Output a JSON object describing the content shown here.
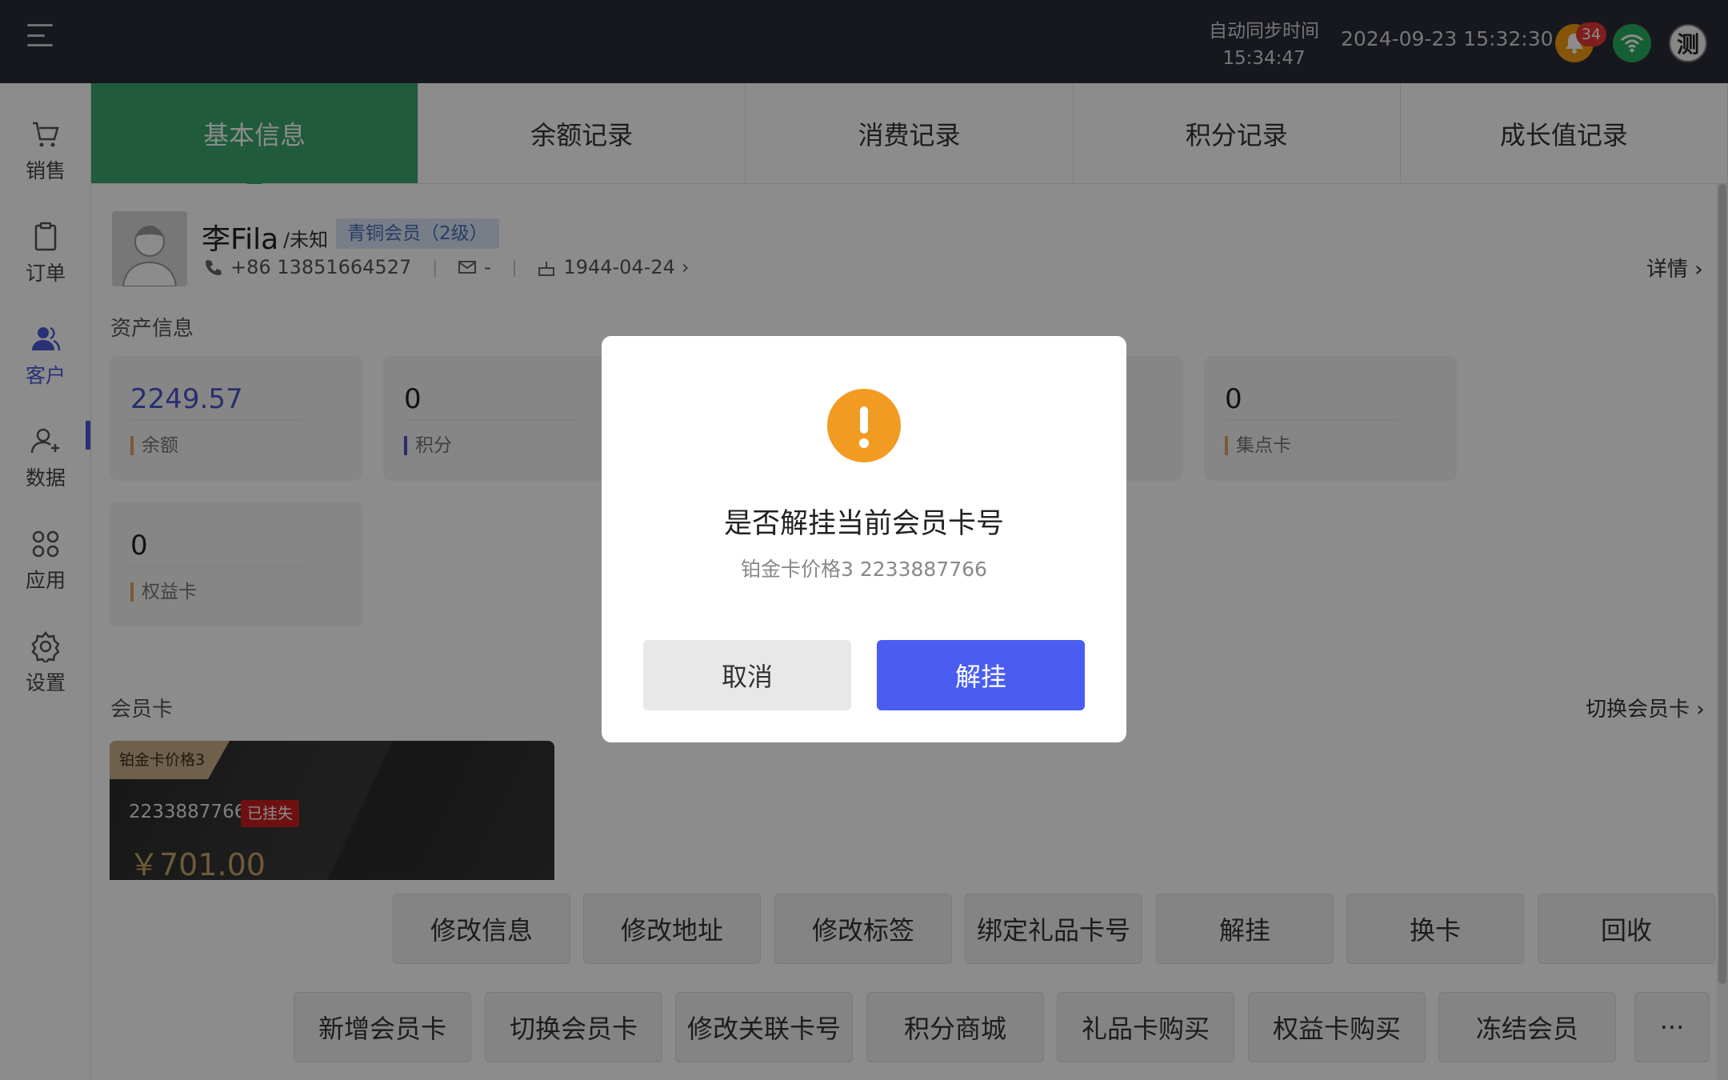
{
  "header": {
    "sync_label": "自动同步时间",
    "sync_time": "15:34:47",
    "datetime": "2024-09-23 15:32:30",
    "notification_count": "34",
    "avatar_glyph": "测"
  },
  "sidebar": {
    "items": [
      {
        "label": "销售",
        "icon": "cart-icon"
      },
      {
        "label": "订单",
        "icon": "clipboard-icon"
      },
      {
        "label": "客户",
        "icon": "users-icon"
      },
      {
        "label": "数据",
        "icon": "user-stats-icon"
      },
      {
        "label": "应用",
        "icon": "grid-apps-icon"
      },
      {
        "label": "设置",
        "icon": "gear-icon"
      }
    ],
    "active_index": 2
  },
  "tabs": [
    "基本信息",
    "余额记录",
    "消费记录",
    "积分记录",
    "成长值记录"
  ],
  "profile": {
    "name": "李Fila",
    "gender": "/未知",
    "level": "青铜会员（2级）",
    "phone": "+86 13851664527",
    "email": "-",
    "birthday": "1944-04-24",
    "birthday_chevron": "›",
    "detail_link": "详情 ›"
  },
  "assets": {
    "title": "资产信息",
    "items": [
      {
        "value": "2249.57",
        "label": "余额"
      },
      {
        "value": "0",
        "label": "积分"
      },
      {
        "value": "0",
        "label": "集点卡"
      },
      {
        "value": "0",
        "label": "权益卡"
      }
    ]
  },
  "member_card": {
    "title": "会员卡",
    "switch_link": "切换会员卡 ›",
    "tag": "铂金卡价格3",
    "card_no": "2233887766",
    "status": "已挂失",
    "amount": "￥701.00"
  },
  "actions": {
    "row1": [
      "修改信息",
      "修改地址",
      "修改标签",
      "绑定礼品卡号",
      "解挂",
      "换卡",
      "回收"
    ],
    "row2": [
      "新增会员卡",
      "切换会员卡",
      "修改关联卡号",
      "积分商城",
      "礼品卡购买",
      "权益卡购买",
      "冻结会员"
    ],
    "more": "···"
  },
  "dialog": {
    "title": "是否解挂当前会员卡号",
    "subtitle": "铂金卡价格3 2233887766",
    "cancel": "取消",
    "confirm": "解挂"
  },
  "colors": {
    "active_tab": "#3aa76d",
    "primary": "#4a5df0",
    "warning": "#f29b22",
    "danger": "#c81e1e"
  }
}
